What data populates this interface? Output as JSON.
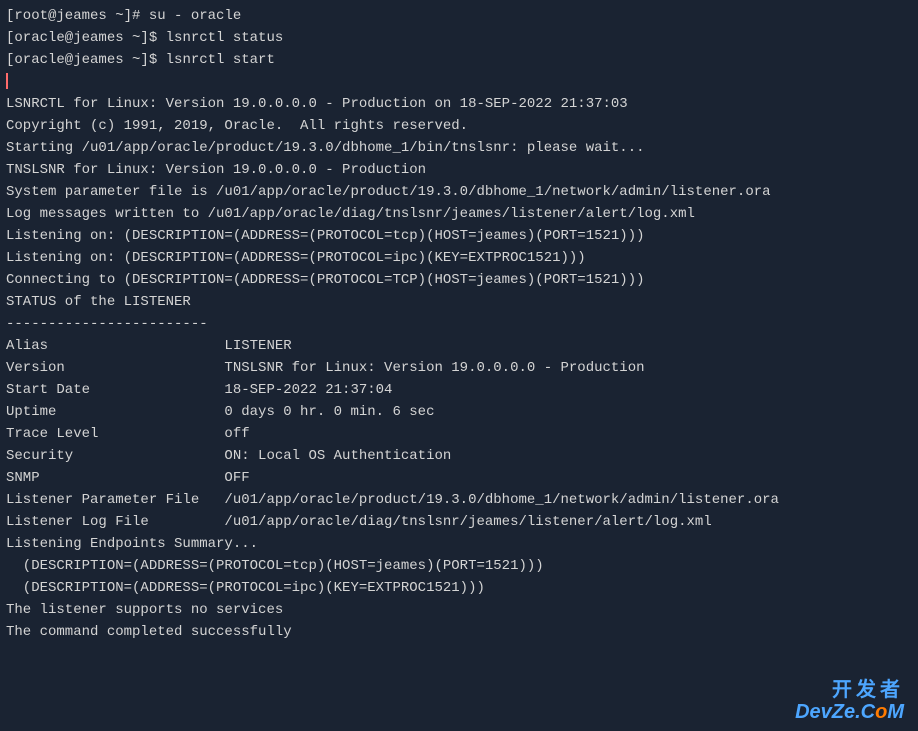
{
  "prompts": {
    "root": "[root@jeames ~]# ",
    "oracle": "[oracle@jeames ~]$ "
  },
  "commands": {
    "su": "su - oracle",
    "status": "lsnrctl status",
    "start": "lsnrctl start"
  },
  "output": {
    "blank1": "",
    "lsnrctl_header": "LSNRCTL for Linux: Version 19.0.0.0.0 - Production on 18-SEP-2022 21:37:03",
    "blank2": "",
    "copyright": "Copyright (c) 1991, 2019, Oracle.  All rights reserved.",
    "blank3": "",
    "starting": "Starting /u01/app/oracle/product/19.3.0/dbhome_1/bin/tnslsnr: please wait...",
    "blank4": "",
    "tnslsnr_header": "TNSLSNR for Linux: Version 19.0.0.0.0 - Production",
    "param_file": "System parameter file is /u01/app/oracle/product/19.3.0/dbhome_1/network/admin/listener.ora",
    "log_messages": "Log messages written to /u01/app/oracle/diag/tnslsnr/jeames/listener/alert/log.xml",
    "listening_tcp": "Listening on: (DESCRIPTION=(ADDRESS=(PROTOCOL=tcp)(HOST=jeames)(PORT=1521)))",
    "listening_ipc": "Listening on: (DESCRIPTION=(ADDRESS=(PROTOCOL=ipc)(KEY=EXTPROC1521)))",
    "blank5": "",
    "connecting": "Connecting to (DESCRIPTION=(ADDRESS=(PROTOCOL=TCP)(HOST=jeames)(PORT=1521)))",
    "status_header": "STATUS of the LISTENER",
    "divider": "------------------------",
    "alias": "Alias                     LISTENER",
    "version": "Version                   TNSLSNR for Linux: Version 19.0.0.0.0 - Production",
    "start_date": "Start Date                18-SEP-2022 21:37:04",
    "uptime": "Uptime                    0 days 0 hr. 0 min. 6 sec",
    "trace_level": "Trace Level               off",
    "security": "Security                  ON: Local OS Authentication",
    "snmp": "SNMP                      OFF",
    "listener_param": "Listener Parameter File   /u01/app/oracle/product/19.3.0/dbhome_1/network/admin/listener.ora",
    "listener_log": "Listener Log File         /u01/app/oracle/diag/tnslsnr/jeames/listener/alert/log.xml",
    "endpoints_header": "Listening Endpoints Summary...",
    "endpoint_tcp": "  (DESCRIPTION=(ADDRESS=(PROTOCOL=tcp)(HOST=jeames)(PORT=1521)))",
    "endpoint_ipc": "  (DESCRIPTION=(ADDRESS=(PROTOCOL=ipc)(KEY=EXTPROC1521)))",
    "no_services": "The listener supports no services",
    "completed": "The command completed successfully"
  },
  "watermark": {
    "cn": "开发者",
    "en_prefix": "DevZe.C",
    "en_o": "o",
    "en_m": "M"
  }
}
